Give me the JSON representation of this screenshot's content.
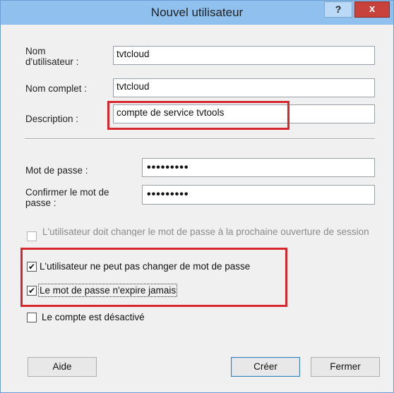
{
  "window": {
    "title": "Nouvel utilisateur",
    "help_button": "?",
    "close_button": "x"
  },
  "form": {
    "username_label": "Nom\nd'utilisateur :",
    "username_value": "tvtcloud",
    "fullname_label": "Nom complet :",
    "fullname_value": "tvtcloud",
    "description_label": "Description :",
    "description_value": "compte de service tvtools",
    "password_label": "Mot de passe :",
    "password_value": "•••••••••",
    "confirm_label": "Confirmer le mot de\npasse :",
    "confirm_value": "•••••••••"
  },
  "options": [
    {
      "label": "L'utilisateur doit changer le mot de passe à la prochaine ouverture de session",
      "checked": false,
      "enabled": false
    },
    {
      "label": "L'utilisateur ne peut pas changer de mot de passe",
      "checked": true,
      "enabled": true
    },
    {
      "label": "Le mot de passe n'expire jamais",
      "checked": true,
      "enabled": true
    },
    {
      "label": "Le compte est désactivé",
      "checked": false,
      "enabled": true
    }
  ],
  "buttons": {
    "help": "Aide",
    "create": "Créer",
    "close": "Fermer"
  },
  "colors": {
    "titlebar": "#8fc0ee",
    "close": "#c7423a",
    "highlight": "#d6272f"
  }
}
